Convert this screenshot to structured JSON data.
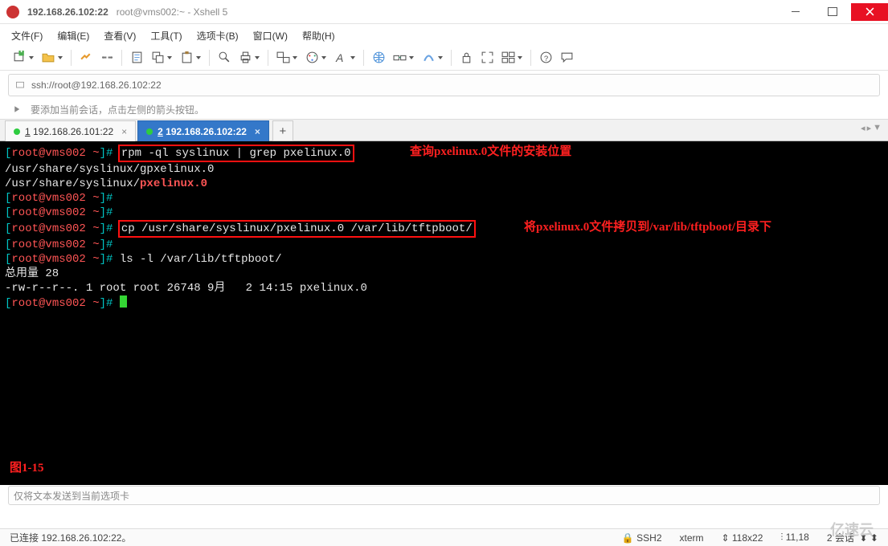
{
  "titlebar": {
    "main": "192.168.26.102:22",
    "sub": "root@vms002:~ - Xshell 5"
  },
  "menu": {
    "file": "文件(F)",
    "edit": "编辑(E)",
    "view": "查看(V)",
    "tools": "工具(T)",
    "tabs": "选项卡(B)",
    "window": "窗口(W)",
    "help": "帮助(H)"
  },
  "addressbar": {
    "text": "ssh://root@192.168.26.102:22"
  },
  "hint": {
    "text": "要添加当前会话，点击左侧的箭头按钮。"
  },
  "tabs": {
    "t1": "1 192.168.26.101:22",
    "t2": "2 192.168.26.102:22",
    "add": "+"
  },
  "term": {
    "p_open": "[",
    "p_user": "root@vms002 ~",
    "p_close": "]#",
    "cmd1": "rpm -ql syslinux | grep pxelinux.0",
    "out1": "/usr/share/syslinux/gpxelinux.0",
    "out2a": "/usr/share/syslinux/",
    "out2b": "pxelinux.0",
    "cmd2": "cp /usr/share/syslinux/pxelinux.0 /var/lib/tftpboot/",
    "cmd3": "ls -l /var/lib/tftpboot/",
    "out3": "总用量 28",
    "out4": "-rw-r--r--. 1 root root 26748 9月   2 14:15 pxelinux.0",
    "annot1": "查询pxelinux.0文件的安装位置",
    "annot2": "将pxelinux.0文件拷贝到/var/lib/tftpboot/目录下",
    "fig": "图1-15"
  },
  "footer": {
    "placeholder": "仅将文本发送到当前选项卡"
  },
  "status": {
    "left": "已连接 192.168.26.102:22。",
    "ssh": "SSH2",
    "term": "xterm",
    "size": "118x22",
    "cursor": "11,18",
    "sessions": "2 会话"
  },
  "watermark": "亿速云"
}
